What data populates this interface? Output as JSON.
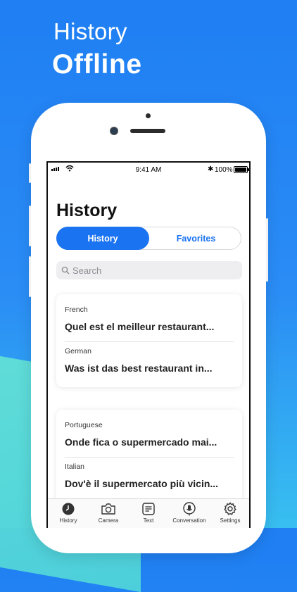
{
  "hero": {
    "line1": "History",
    "line2": "Offline"
  },
  "status_bar": {
    "time": "9:41 AM",
    "battery": "100%"
  },
  "page_title": "History",
  "segments": {
    "active": "History",
    "inactive": "Favorites"
  },
  "search": {
    "placeholder": "Search"
  },
  "cards": [
    {
      "entries": [
        {
          "language": "French",
          "phrase": "Quel est el meilleur restaurant..."
        },
        {
          "language": "German",
          "phrase": "Was ist das best restaurant in..."
        }
      ]
    },
    {
      "entries": [
        {
          "language": "Portuguese",
          "phrase": "Onde fica o supermercado mai..."
        },
        {
          "language": "Italian",
          "phrase": "Dov'è il supermercato più vicin..."
        }
      ]
    }
  ],
  "tabs": [
    "History",
    "Camera",
    "Text",
    "Conversation",
    "Settings"
  ],
  "colors": {
    "accent": "#1a73f0",
    "background_top": "#1f7ff3",
    "background_bottom": "#38bff0"
  }
}
